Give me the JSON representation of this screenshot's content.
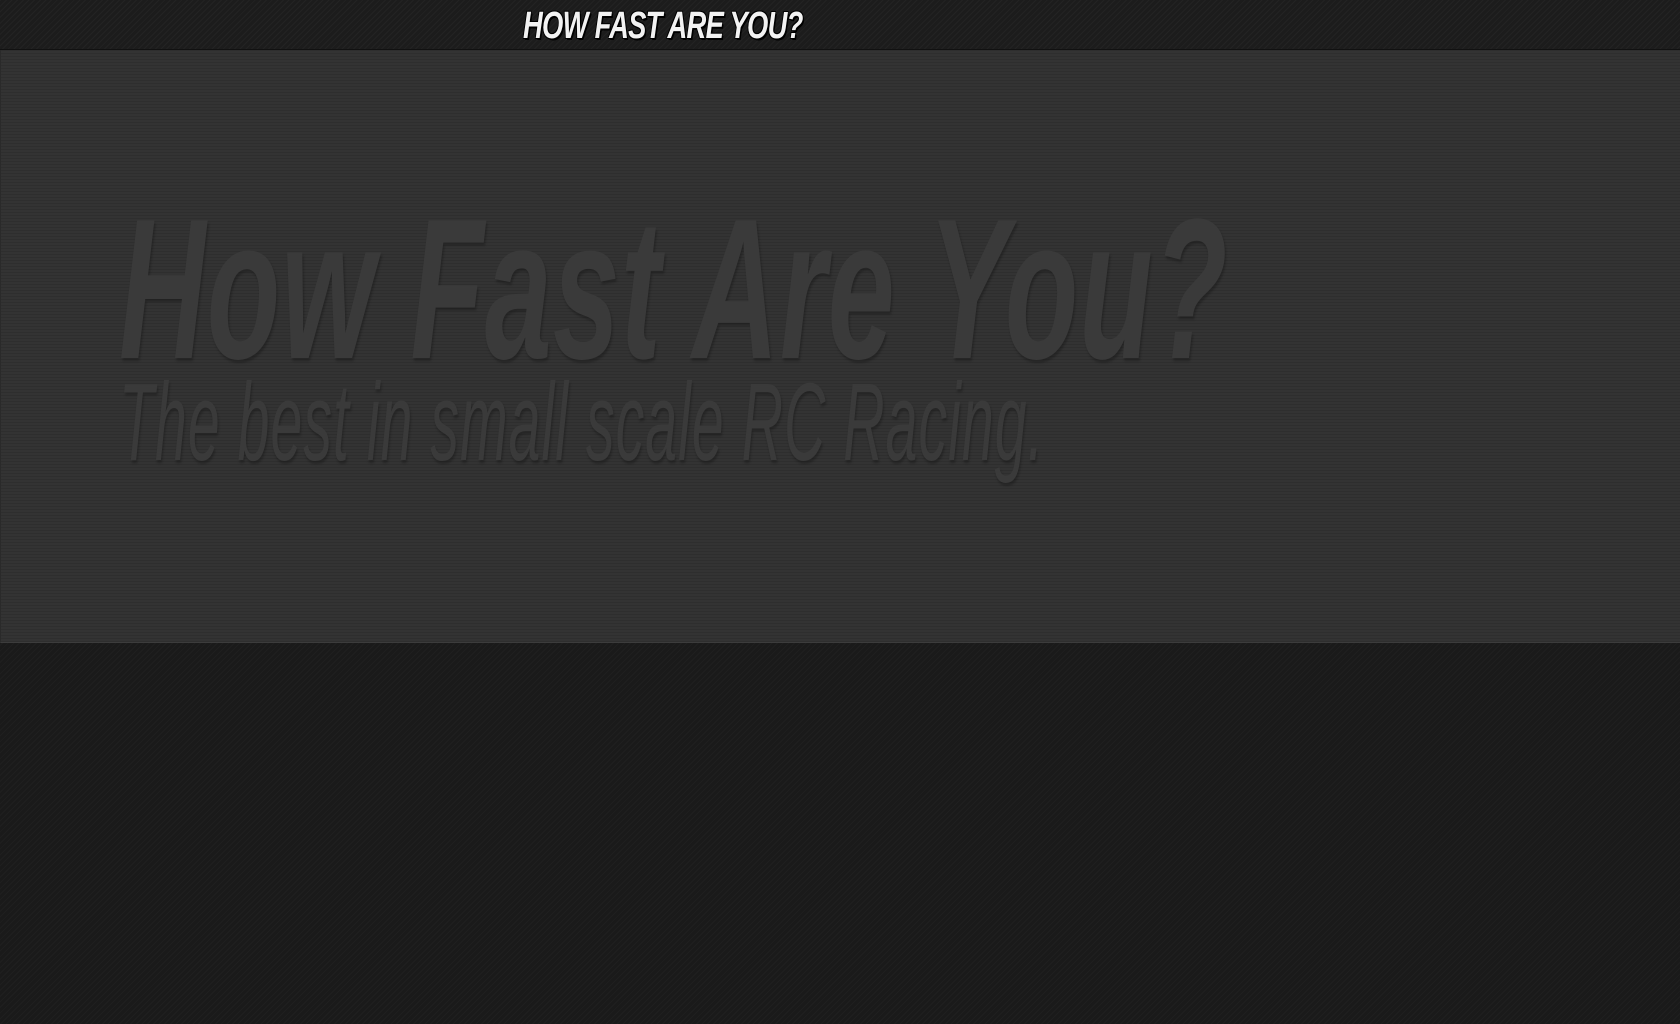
{
  "header": {
    "logo_text": "HOW FAST ARE YOU?"
  },
  "hero": {
    "title": "How Fast Are You?",
    "subtitle": "The best in small scale RC Racing."
  },
  "colors": {
    "page_background": "#1a1a1a",
    "hero_background": "#333333",
    "hero_text": "#3a3a3a",
    "logo_text": "#f2f2f2"
  }
}
